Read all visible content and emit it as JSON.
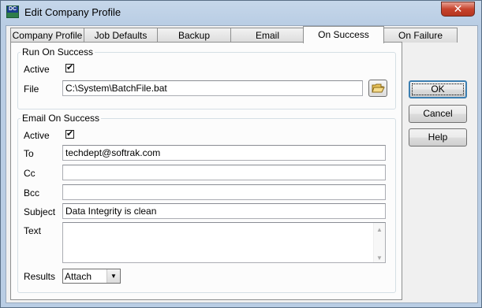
{
  "window": {
    "title": "Edit Company Profile",
    "icon_text": "DC",
    "close_glyph": "✕"
  },
  "tabs": [
    {
      "label": "Company Profile",
      "active": false
    },
    {
      "label": "Job Defaults",
      "active": false
    },
    {
      "label": "Backup",
      "active": false
    },
    {
      "label": "Email",
      "active": false
    },
    {
      "label": "On Success",
      "active": true
    },
    {
      "label": "On Failure",
      "active": false
    }
  ],
  "run_on_success": {
    "group_label": "Run On Success",
    "active_label": "Active",
    "active_checked": true,
    "file_label": "File",
    "file_value": "C:\\System\\BatchFile.bat",
    "browse_icon": "folder-open-icon"
  },
  "email_on_success": {
    "group_label": "Email On Success",
    "active_label": "Active",
    "active_checked": true,
    "to_label": "To",
    "to_value": "techdept@softrak.com",
    "cc_label": "Cc",
    "cc_value": "",
    "bcc_label": "Bcc",
    "bcc_value": "",
    "subject_label": "Subject",
    "subject_value": "Data Integrity is clean",
    "text_label": "Text",
    "text_value": "",
    "results_label": "Results",
    "results_value": "Attach"
  },
  "buttons": {
    "ok": "OK",
    "cancel": "Cancel",
    "help": "Help"
  },
  "check_glyph": "✔"
}
